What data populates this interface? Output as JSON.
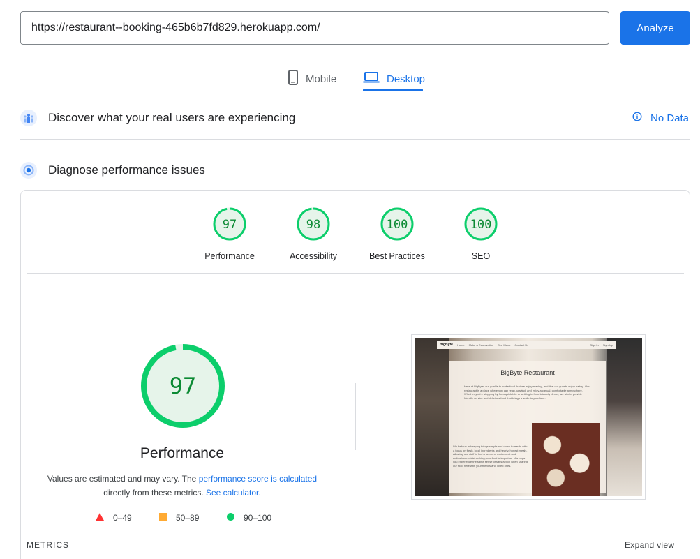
{
  "url_bar": {
    "value": "https://restaurant--booking-465b6b7fd829.herokuapp.com/",
    "analyze_label": "Analyze"
  },
  "device_tabs": [
    {
      "label": "Mobile",
      "icon": "smartphone-icon",
      "selected": false
    },
    {
      "label": "Desktop",
      "icon": "laptop-icon",
      "selected": true
    }
  ],
  "field_data": {
    "title": "Discover what your real users are experiencing",
    "status_label": "No Data",
    "icon": "crux-users-icon"
  },
  "lab_data": {
    "title": "Diagnose performance issues",
    "icon": "lighthouse-icon"
  },
  "category_scores": [
    {
      "label": "Performance",
      "score": 97
    },
    {
      "label": "Accessibility",
      "score": 98
    },
    {
      "label": "Best Practices",
      "score": 100
    },
    {
      "label": "SEO",
      "score": 100
    }
  ],
  "performance": {
    "score": 97,
    "title": "Performance",
    "note_prefix": "Values are estimated and may vary. The",
    "note_link_score": "performance score is calculated",
    "note_middle": "directly from these metrics.",
    "note_link_calc": "See calculator."
  },
  "legend": [
    {
      "range": "0–49",
      "shape": "triangle",
      "color": "#ff3333"
    },
    {
      "range": "50–89",
      "shape": "square",
      "color": "#ffaa33"
    },
    {
      "range": "90–100",
      "shape": "circle",
      "color": "#0cce6b"
    }
  ],
  "thumbnail": {
    "brand": "BigByte",
    "nav_items": [
      "Home",
      "Make a Reservation",
      "See Menu",
      "Contact Us"
    ],
    "auth_items": [
      "Sign In",
      "Sign Up"
    ],
    "heading": "BigByte Restaurant",
    "paragraph_1": "Here at BigByte, our goal is to make food that we enjoy making, and that our guests enjoy eating. Our restaurant is a place where you can relax, unwind, and enjoy a casual, comfortable atmosphere. Whether you're stopping by for a quick bite or settling in for a leisurely dinner, we aim to provide friendly service and delicious food that brings a smile to your face.",
    "paragraph_2": "We believe in keeping things simple and down-to-earth, with a focus on fresh, local ingredients and hearty, honest meals. Allowing our staff to find a sense of excitement and enthusiasm whilst making your food is important. We hope you experience the same sense of satisfaction when sharing our food here with your friends and loved ones."
  },
  "metrics_section": {
    "heading": "METRICS",
    "expand_label": "Expand view"
  },
  "colors": {
    "accent": "#1a73e8",
    "pass": "#0cce6b",
    "pass_text": "#0c8a34",
    "pass_fill": "#e6f4ea"
  }
}
